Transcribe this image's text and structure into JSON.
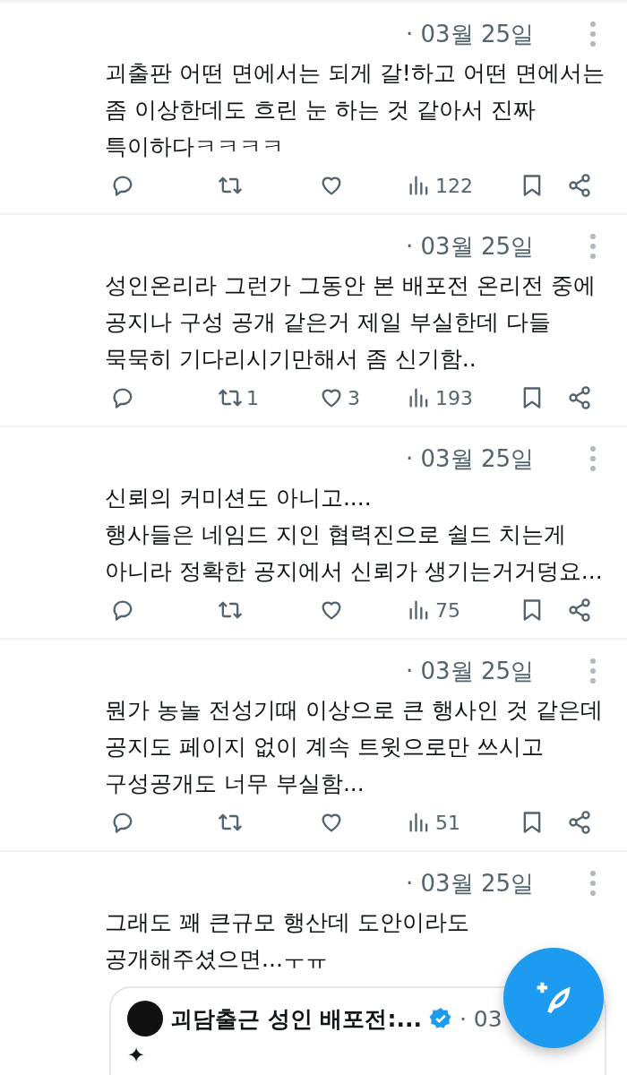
{
  "tweets": [
    {
      "date": "· 03월 25일",
      "text": "괴출판 어떤 면에서는 되게 갈!하고 어떤 면에서는\n좀 이상한데도 흐린 눈 하는 것 같아서 진짜\n특이하다ㅋㅋㅋㅋ",
      "actions": {
        "views": "122"
      }
    },
    {
      "date": "· 03월 25일",
      "text": "성인온리라 그런가 그동안 본 배포전 온리전 중에\n공지나 구성 공개 같은거 제일 부실한데 다들\n묵묵히 기다리시기만해서 좀 신기함..",
      "actions": {
        "retweets": "1",
        "likes": "3",
        "views": "193"
      }
    },
    {
      "date": "· 03월 25일",
      "text": "신뢰의 커미션도 아니고....\n행사들은 네임드 지인 협력진으로 쉴드 치는게\n아니라 정확한 공지에서 신뢰가 생기는거거덩요...",
      "actions": {
        "views": "75"
      }
    },
    {
      "date": "· 03월 25일",
      "text": "뭔가 농놀 전성기때 이상으로 큰 행사인 것 같은데\n공지도 페이지 없이 계속 트윗으로만 쓰시고\n구성공개도 너무 부실함...",
      "actions": {
        "views": "51"
      }
    },
    {
      "date": "· 03월 25일",
      "text": "그래도 꽤 큰규모 행산데 도안이라도\n공개해주셨으면...ㅜㅠ",
      "quote": {
        "name": "괴담출근 성인 배포전:...",
        "verified": true,
        "date": "· 03",
        "text": "✦"
      }
    }
  ]
}
